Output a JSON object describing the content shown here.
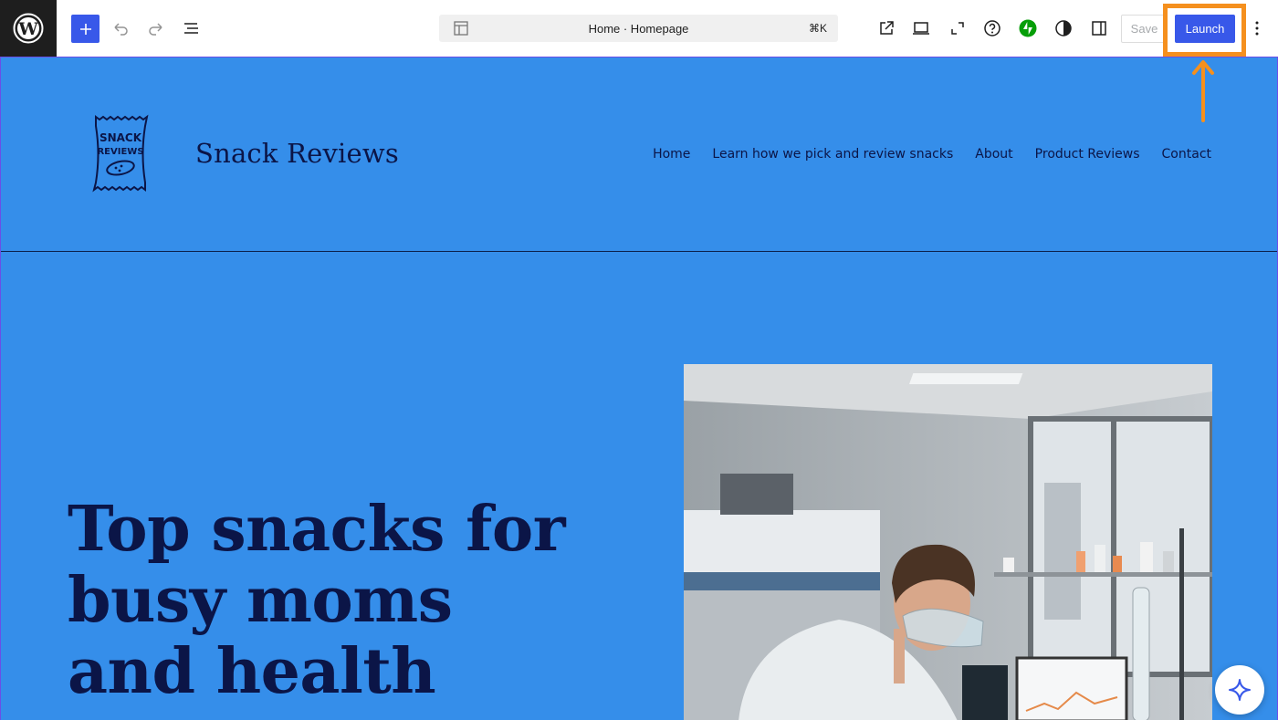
{
  "toolbar": {
    "document_title": "Home · Homepage",
    "shortcut": "⌘K",
    "save_label": "Save",
    "launch_label": "Launch",
    "icons": [
      "wordpress-logo",
      "plus-icon",
      "undo-icon",
      "redo-icon",
      "list-view-icon",
      "template-icon",
      "external-link-icon",
      "desktop-preview-icon",
      "fullscreen-icon",
      "help-icon",
      "jetpack-icon",
      "contrast-icon",
      "sidebar-icon",
      "more-options-icon"
    ]
  },
  "site": {
    "title": "Snack Reviews",
    "logo_text_top": "SNACK",
    "logo_text_bottom": "REVIEWS",
    "nav": [
      {
        "label": "Home"
      },
      {
        "label": "Learn how we pick and review snacks"
      },
      {
        "label": "About"
      },
      {
        "label": "Product Reviews"
      },
      {
        "label": "Contact"
      }
    ],
    "hero_title": "Top snacks for busy moms and health"
  },
  "colors": {
    "canvas_bg": "#358eea",
    "text_dark": "#0b1547",
    "wp_blue": "#3858e9",
    "highlight_orange": "#f5901e",
    "jetpack_green": "#069e08"
  }
}
